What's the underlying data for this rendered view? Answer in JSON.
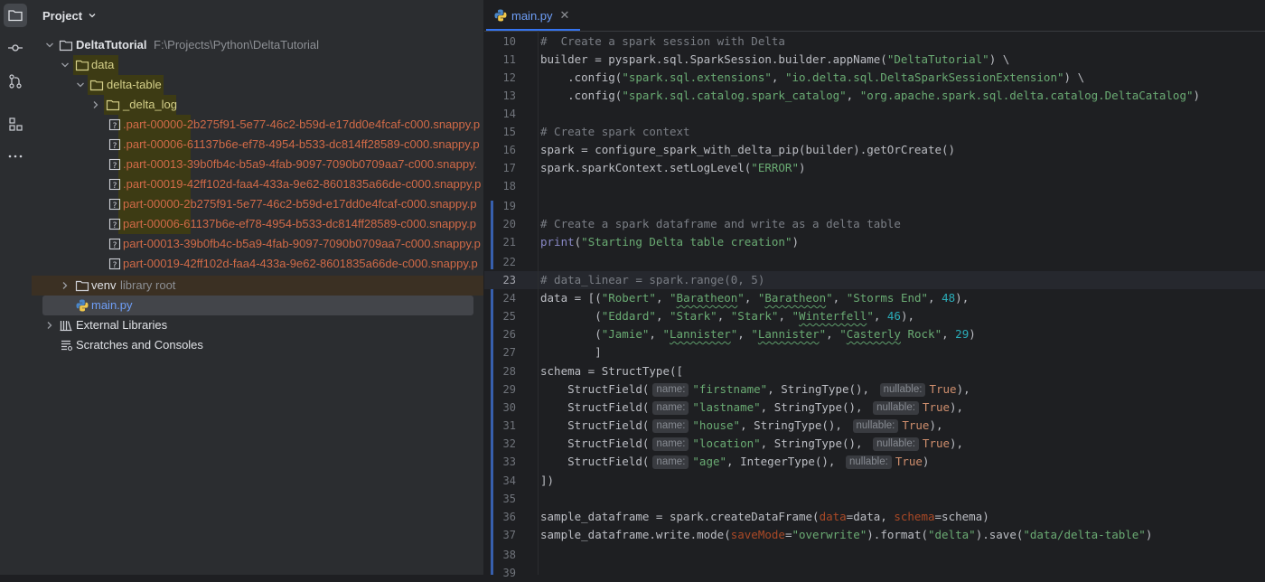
{
  "project_panel": {
    "title": "Project",
    "tree": [
      {
        "label": "DeltaTutorial",
        "path": "F:\\Projects\\Python\\DeltaTutorial"
      },
      {
        "label": "data"
      },
      {
        "label": "delta-table"
      },
      {
        "label": "_delta_log"
      },
      {
        "label": ".part-00000-2b275f91-5e77-46c2-b59d-e17dd0e4fcaf-c000.snappy.p"
      },
      {
        "label": ".part-00006-61137b6e-ef78-4954-b533-dc814ff28589-c000.snappy.p"
      },
      {
        "label": ".part-00013-39b0fb4c-b5a9-4fab-9097-7090b0709aa7-c000.snappy."
      },
      {
        "label": ".part-00019-42ff102d-faa4-433a-9e62-8601835a66de-c000.snappy.p"
      },
      {
        "label": "part-00000-2b275f91-5e77-46c2-b59d-e17dd0e4fcaf-c000.snappy.p"
      },
      {
        "label": "part-00006-61137b6e-ef78-4954-b533-dc814ff28589-c000.snappy.p"
      },
      {
        "label": "part-00013-39b0fb4c-b5a9-4fab-9097-7090b0709aa7-c000.snappy.p"
      },
      {
        "label": "part-00019-42ff102d-faa4-433a-9e62-8601835a66de-c000.snappy.p"
      },
      {
        "label": "venv",
        "note": "library root"
      },
      {
        "label": "main.py"
      },
      {
        "label": "External Libraries"
      },
      {
        "label": "Scratches and Consoles"
      }
    ]
  },
  "editor": {
    "tab_label": "main.py",
    "line_numbers": [
      "10",
      "11",
      "12",
      "13",
      "14",
      "15",
      "16",
      "17",
      "18",
      "19",
      "20",
      "21",
      "22",
      "23",
      "24",
      "25",
      "26",
      "27",
      "28",
      "29",
      "30",
      "31",
      "32",
      "33",
      "34",
      "35",
      "36",
      "37",
      "38",
      "39"
    ],
    "current_line": "23",
    "hints": {
      "name": "name:",
      "nullable": "nullable:"
    },
    "lines": {
      "l10": "#  Create a spark session with Delta",
      "l11a": "builder = pyspark.sql.SparkSession.builder.appName(",
      "l11b": "\"DeltaTutorial\"",
      "l11c": ") \\",
      "l12a": "    .config(",
      "l12b": "\"spark.sql.extensions\"",
      "l12c": ", ",
      "l12d": "\"io.delta.sql.DeltaSparkSessionExtension\"",
      "l12e": ") \\",
      "l13a": "    .config(",
      "l13b": "\"spark.sql.catalog.spark_catalog\"",
      "l13c": ", ",
      "l13d": "\"org.apache.spark.sql.delta.catalog.DeltaCatalog\"",
      "l13e": ")",
      "l15": "# Create spark context",
      "l16": "spark = configure_spark_with_delta_pip(builder).getOrCreate()",
      "l17a": "spark.sparkContext.setLogLevel(",
      "l17b": "\"ERROR\"",
      "l17c": ")",
      "l20": "# Create a spark dataframe and write as a delta table",
      "l21a": "print",
      "l21b": "(",
      "l21c": "\"Starting Delta table creation\"",
      "l21d": ")",
      "l23": "# data_linear = spark.range(0, 5)",
      "l24": {
        "a": "data = [(",
        "b": "\"Robert\"",
        "c": ", ",
        "d": "\"",
        "e": "Baratheon",
        "f": "\"",
        "g": ", ",
        "h": "\"",
        "i": "Baratheon",
        "j": "\"",
        "k": ", ",
        "l": "\"Storms End\"",
        "m": ", ",
        "n": "48",
        "o": "),"
      },
      "l25": {
        "a": "        (",
        "b": "\"Eddard\"",
        "c": ", ",
        "d": "\"Stark\"",
        "e": ", ",
        "f": "\"Stark\"",
        "g": ", ",
        "h": "\"",
        "i": "Winterfell",
        "j": "\"",
        "k": ", ",
        "l": "46",
        "m": "),"
      },
      "l26": {
        "a": "        (",
        "b": "\"Jamie\"",
        "c": ", ",
        "d": "\"",
        "e": "Lannister",
        "f": "\"",
        "g": ", ",
        "h": "\"",
        "i": "Lannister",
        "j": "\"",
        "k": ", ",
        "l": "\"",
        "m": "Casterly",
        "n": " Rock\"",
        "o": ", ",
        "p": "29",
        "q": ")"
      },
      "l27": "        ]",
      "l28": "schema = StructType([",
      "l29": {
        "a": "    StructField(",
        "b": "\"firstname\"",
        "c": ", StringType(), ",
        "d": "True",
        "e": "),"
      },
      "l30": {
        "a": "    StructField(",
        "b": "\"lastname\"",
        "c": ", StringType(), ",
        "d": "True",
        "e": "),"
      },
      "l31": {
        "a": "    StructField(",
        "b": "\"house\"",
        "c": ", StringType(), ",
        "d": "True",
        "e": "),"
      },
      "l32": {
        "a": "    StructField(",
        "b": "\"location\"",
        "c": ", StringType(), ",
        "d": "True",
        "e": "),"
      },
      "l33": {
        "a": "    StructField(",
        "b": "\"age\"",
        "c": ", IntegerType(), ",
        "d": "True",
        "e": ")"
      },
      "l34": "])",
      "l36": {
        "a": "sample_dataframe = spark.createDataFrame(",
        "b": "data",
        "c": "=data, ",
        "d": "schema",
        "e": "=schema)"
      },
      "l37": {
        "a": "sample_dataframe.write.mode(",
        "b": "saveMode",
        "c": "=",
        "d": "\"overwrite\"",
        "e": ").format(",
        "f": "\"delta\"",
        "g": ").save(",
        "h": "\"data/delta-table\"",
        "i": ")"
      }
    }
  }
}
